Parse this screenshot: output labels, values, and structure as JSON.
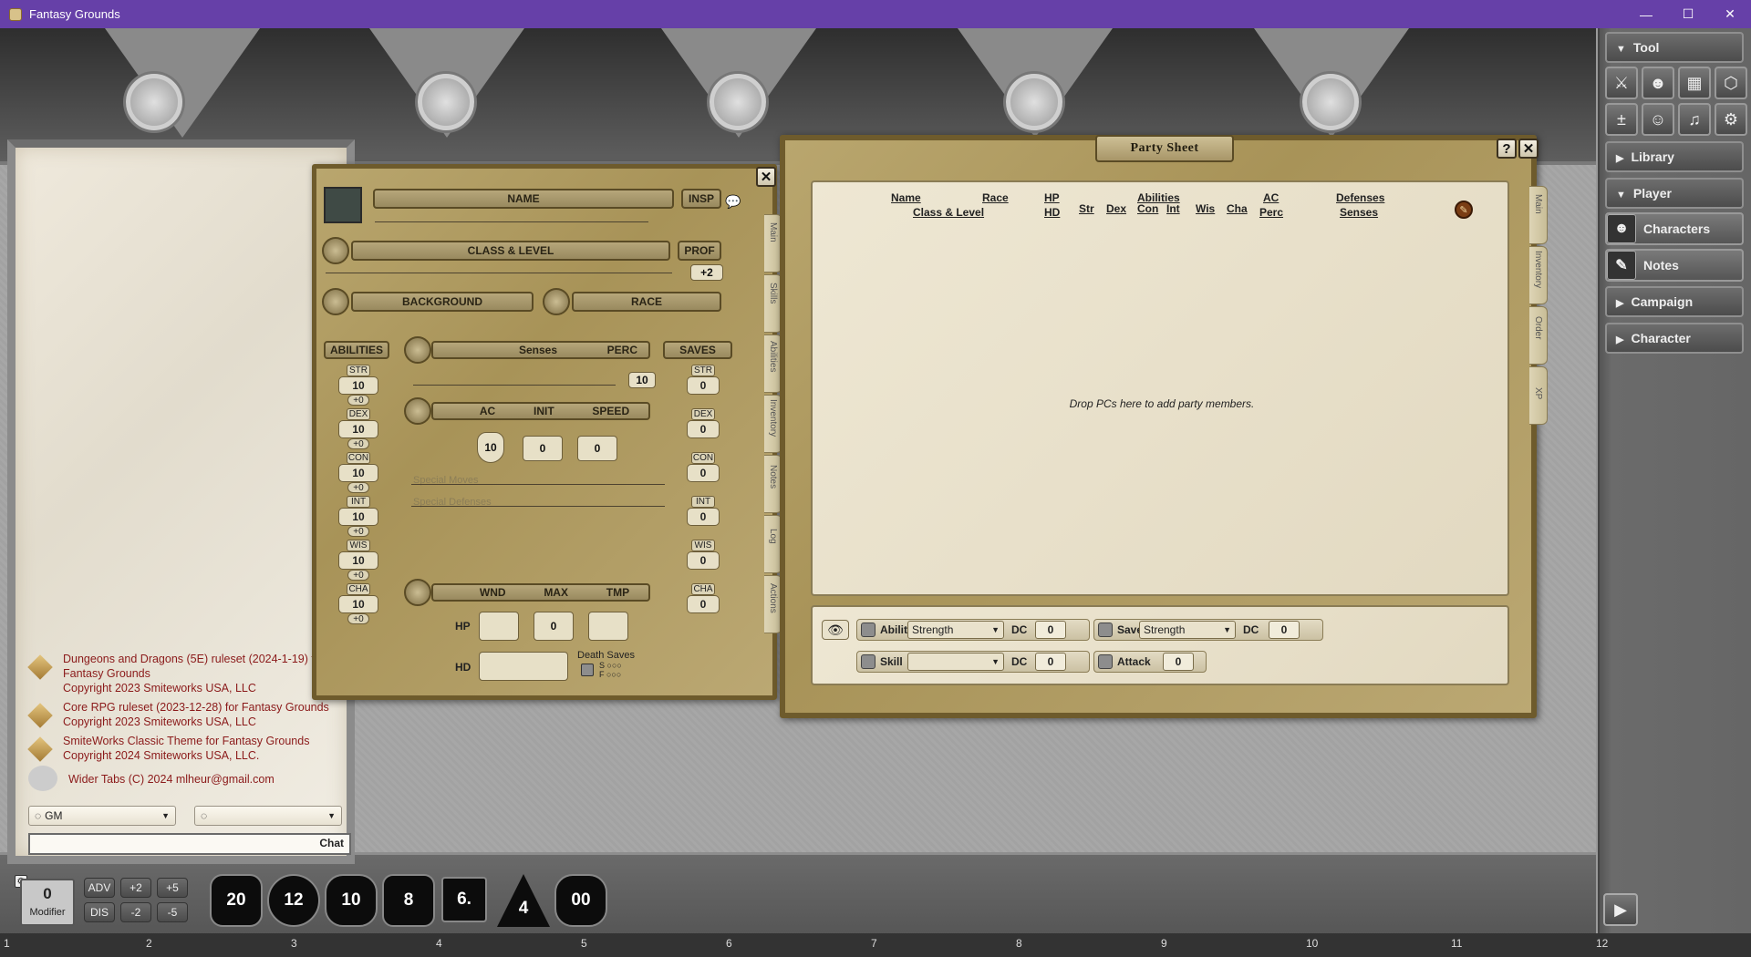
{
  "window": {
    "title": "Fantasy Grounds",
    "minimize": "—",
    "maximize": "☐",
    "close": "✕"
  },
  "sidebar": {
    "tool_label": "Tool",
    "library_label": "Library",
    "player_label": "Player",
    "characters_label": "Characters",
    "notes_label": "Notes",
    "campaign_label": "Campaign",
    "character_label": "Character",
    "collapse_glyph": "▼",
    "expand_glyph": "▶"
  },
  "chat": {
    "messages": [
      {
        "line1": "Dungeons and Dragons (5E) ruleset (2024-1-19) for",
        "line2": "Fantasy Grounds",
        "line3": "Copyright 2023 Smiteworks USA, LLC"
      },
      {
        "line1": "Core RPG ruleset (2023-12-28) for Fantasy Grounds",
        "line2": "Copyright 2023 Smiteworks USA, LLC"
      },
      {
        "line1": "SmiteWorks Classic Theme for Fantasy Grounds",
        "line2": "Copyright 2024 Smiteworks USA, LLC."
      },
      {
        "line1": "Wider Tabs (C) 2024 mlheur@gmail.com"
      }
    ],
    "speaker": "GM",
    "mode": "",
    "input_value": "",
    "chat_button": "Chat"
  },
  "charsheet": {
    "name_label": "NAME",
    "insp_label": "INSP",
    "class_label": "CLASS & LEVEL",
    "prof_label": "PROF",
    "prof_value": "+2",
    "background_label": "BACKGROUND",
    "race_label": "RACE",
    "abilities_label": "ABILITIES",
    "senses_label": "Senses",
    "perc_label": "PERC",
    "perc_value": "10",
    "saves_label": "SAVES",
    "ac_label": "AC",
    "init_label": "INIT",
    "speed_label": "SPEED",
    "ac_value": "10",
    "init_value": "0",
    "speed_value": "0",
    "special_moves_placeholder": "Special Moves",
    "special_defenses_placeholder": "Special Defenses",
    "wnd_label": "WND",
    "max_label": "MAX",
    "tmp_label": "TMP",
    "hp_label": "HP",
    "hp_max": "0",
    "hd_label": "HD",
    "death_saves_label": "Death Saves",
    "death_s": "S",
    "death_f": "F",
    "abilities": [
      {
        "name": "STR",
        "score": "10",
        "mod": "+0"
      },
      {
        "name": "DEX",
        "score": "10",
        "mod": "+0"
      },
      {
        "name": "CON",
        "score": "10",
        "mod": "+0"
      },
      {
        "name": "INT",
        "score": "10",
        "mod": "+0"
      },
      {
        "name": "WIS",
        "score": "10",
        "mod": "+0"
      },
      {
        "name": "CHA",
        "score": "10",
        "mod": "+0"
      }
    ],
    "saves": [
      {
        "name": "STR",
        "value": "0"
      },
      {
        "name": "DEX",
        "value": "0"
      },
      {
        "name": "CON",
        "value": "0"
      },
      {
        "name": "INT",
        "value": "0"
      },
      {
        "name": "WIS",
        "value": "0"
      },
      {
        "name": "CHA",
        "value": "0"
      }
    ],
    "tabs": [
      "Main",
      "Skills",
      "Abilities",
      "Inventory",
      "Notes",
      "Log",
      "Actions"
    ]
  },
  "party": {
    "title": "Party Sheet",
    "help": "?",
    "columns": {
      "name": "Name",
      "class_level": "Class & Level",
      "race": "Race",
      "hp": "HP",
      "hd": "HD",
      "abilities": "Abilities",
      "str": "Str",
      "dex": "Dex",
      "con": "Con",
      "int": "Int",
      "wis": "Wis",
      "cha": "Cha",
      "ac": "AC",
      "perc": "Perc",
      "defenses": "Defenses",
      "senses": "Senses"
    },
    "empty_message": "Drop PCs here to add party members.",
    "tabs": [
      "Main",
      "Inventory",
      "Order",
      "XP"
    ],
    "ability_label": "Ability",
    "ability_value": "Strength",
    "dc_label": "DC",
    "ability_dc": "0",
    "save_label": "Save",
    "save_value": "Strength",
    "save_dc": "0",
    "skill_label": "Skill",
    "skill_value": "",
    "skill_dc": "0",
    "attack_label": "Attack",
    "attack_value": "0"
  },
  "dicebar": {
    "modifier_value": "0",
    "modifier_label": "Modifier",
    "adv": "ADV",
    "dis": "DIS",
    "plus2": "+2",
    "plus5": "+5",
    "minus2": "-2",
    "minus5": "-5",
    "dice": [
      "20",
      "12",
      "10",
      "8",
      "6.",
      "4",
      "00"
    ]
  },
  "ruler": [
    "1",
    "2",
    "3",
    "4",
    "5",
    "6",
    "7",
    "8",
    "9",
    "10",
    "11",
    "12"
  ]
}
